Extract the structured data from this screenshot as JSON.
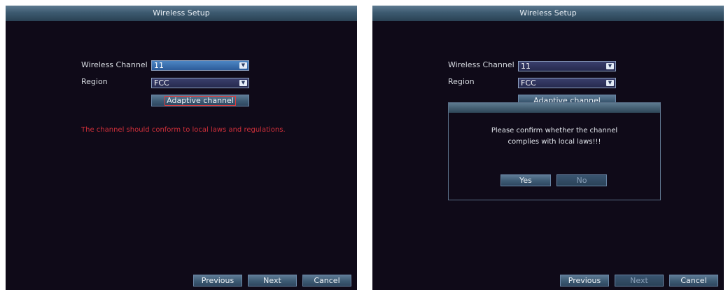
{
  "left_screen": {
    "title": "Wireless Setup",
    "channel_label": "Wireless Channel",
    "channel_value": "11",
    "region_label": "Region",
    "region_value": "FCC",
    "adaptive_button": "Adaptive channel",
    "warning": "The channel should conform to local laws and regulations.",
    "previous_button": "Previous",
    "next_button": "Next",
    "cancel_button": "Cancel"
  },
  "right_screen": {
    "title": "Wireless Setup",
    "channel_label": "Wireless Channel",
    "channel_value": "11",
    "region_label": "Region",
    "region_value": "FCC",
    "adaptive_button": "Adaptive channel",
    "dialog": {
      "message_line1": "Please confirm whether the channel",
      "message_line2": "complies with local laws!!!",
      "yes_button": "Yes",
      "no_button": "No"
    },
    "previous_button": "Previous",
    "next_button": "Next",
    "cancel_button": "Cancel"
  },
  "icons": {
    "dropdown": "chevron-down-icon"
  }
}
